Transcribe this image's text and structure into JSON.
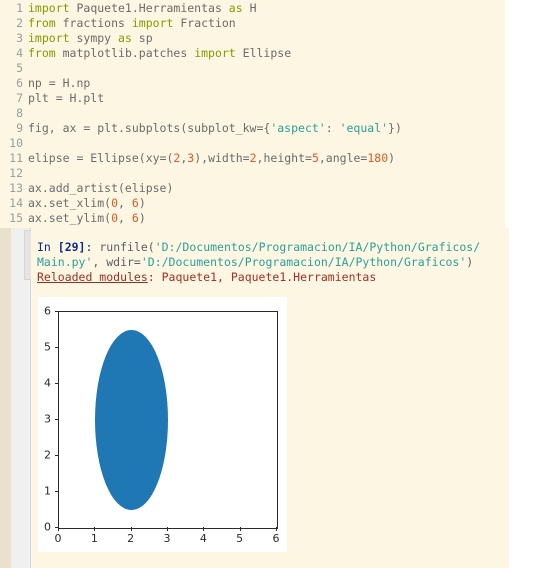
{
  "editor": {
    "name": "python-code-editor",
    "background": "#fdf6e3",
    "lines": [
      {
        "n": "1",
        "tokens": [
          {
            "t": "import",
            "c": "kw"
          },
          {
            "t": " Paquete1.Herramientas ",
            "c": "pln"
          },
          {
            "t": "as",
            "c": "kw"
          },
          {
            "t": " H",
            "c": "pln"
          }
        ]
      },
      {
        "n": "2",
        "tokens": [
          {
            "t": "from",
            "c": "kw"
          },
          {
            "t": " fractions ",
            "c": "pln"
          },
          {
            "t": "import",
            "c": "kw"
          },
          {
            "t": " Fraction",
            "c": "pln"
          }
        ]
      },
      {
        "n": "3",
        "tokens": [
          {
            "t": "import",
            "c": "kw"
          },
          {
            "t": " sympy ",
            "c": "pln"
          },
          {
            "t": "as",
            "c": "kw"
          },
          {
            "t": " sp",
            "c": "pln"
          }
        ]
      },
      {
        "n": "4",
        "tokens": [
          {
            "t": "from",
            "c": "kw"
          },
          {
            "t": " matplotlib.patches ",
            "c": "pln"
          },
          {
            "t": "import",
            "c": "kw"
          },
          {
            "t": " Ellipse",
            "c": "pln"
          }
        ]
      },
      {
        "n": "5",
        "tokens": []
      },
      {
        "n": "6",
        "tokens": [
          {
            "t": "np = H.np",
            "c": "pln"
          }
        ]
      },
      {
        "n": "7",
        "tokens": [
          {
            "t": "plt = H.plt",
            "c": "pln"
          }
        ]
      },
      {
        "n": "8",
        "tokens": []
      },
      {
        "n": "9",
        "tokens": [
          {
            "t": "fig, ax = plt.subplots(subplot_kw={",
            "c": "pln"
          },
          {
            "t": "'aspect'",
            "c": "str"
          },
          {
            "t": ": ",
            "c": "pln"
          },
          {
            "t": "'equal'",
            "c": "str"
          },
          {
            "t": "})",
            "c": "pln"
          }
        ]
      },
      {
        "n": "10",
        "tokens": []
      },
      {
        "n": "11",
        "tokens": [
          {
            "t": "elipse = Ellipse(xy=(",
            "c": "pln"
          },
          {
            "t": "2",
            "c": "num"
          },
          {
            "t": ",",
            "c": "pln"
          },
          {
            "t": "3",
            "c": "num"
          },
          {
            "t": "),width=",
            "c": "pln"
          },
          {
            "t": "2",
            "c": "num"
          },
          {
            "t": ",height=",
            "c": "pln"
          },
          {
            "t": "5",
            "c": "num"
          },
          {
            "t": ",angle=",
            "c": "pln"
          },
          {
            "t": "180",
            "c": "num"
          },
          {
            "t": ")",
            "c": "pln"
          }
        ]
      },
      {
        "n": "12",
        "tokens": []
      },
      {
        "n": "13",
        "tokens": [
          {
            "t": "ax.add_artist(elipse)",
            "c": "pln"
          }
        ]
      },
      {
        "n": "14",
        "tokens": [
          {
            "t": "ax.set_xlim(",
            "c": "pln"
          },
          {
            "t": "0",
            "c": "num"
          },
          {
            "t": ", ",
            "c": "pln"
          },
          {
            "t": "6",
            "c": "num"
          },
          {
            "t": ")",
            "c": "pln"
          }
        ]
      },
      {
        "n": "15",
        "tokens": [
          {
            "t": "ax.set_ylim(",
            "c": "pln"
          },
          {
            "t": "0",
            "c": "num"
          },
          {
            "t": ", ",
            "c": "pln"
          },
          {
            "t": "6",
            "c": "num"
          },
          {
            "t": ")",
            "c": "pln"
          }
        ]
      }
    ]
  },
  "console": {
    "name": "ipython-console",
    "background": "#fdf6e3",
    "lines": [
      {
        "tokens": [
          {
            "t": "In ",
            "c": "c-in"
          },
          {
            "t": "[29]",
            "c": "c-innum"
          },
          {
            "t": ": ",
            "c": "c-in"
          },
          {
            "t": "runfile(",
            "c": "c-fn"
          },
          {
            "t": "'D:/Documentos/Programacion/IA/Python/Graficos/",
            "c": "c-path"
          }
        ]
      },
      {
        "tokens": [
          {
            "t": "Main.py'",
            "c": "c-path"
          },
          {
            "t": ", wdir=",
            "c": "c-fn"
          },
          {
            "t": "'D:/Documentos/Programacion/IA/Python/Graficos'",
            "c": "c-path"
          },
          {
            "t": ")",
            "c": "c-fn"
          }
        ]
      },
      {
        "tokens": [
          {
            "t": "Reloaded modules",
            "c": "c-reload"
          },
          {
            "t": ": Paquete1, Paquete1.Herramientas",
            "c": "c-red"
          }
        ]
      }
    ]
  },
  "chart_data": {
    "type": "scatter",
    "title": "",
    "xlabel": "",
    "ylabel": "",
    "xlim": [
      0,
      6
    ],
    "ylim": [
      0,
      6
    ],
    "xticks": [
      0,
      1,
      2,
      3,
      4,
      5,
      6
    ],
    "yticks": [
      0,
      1,
      2,
      3,
      4,
      5,
      6
    ],
    "xticklabels": [
      "0",
      "1",
      "2",
      "3",
      "4",
      "5",
      "6"
    ],
    "yticklabels": [
      "0",
      "1",
      "2",
      "3",
      "4",
      "5",
      "6"
    ],
    "grid": false,
    "legend": false,
    "aspect": "equal",
    "figure_facecolor": "#ffffff",
    "axes_facecolor": "#ffffff",
    "spine_color": "#2b2b2b",
    "patches": [
      {
        "kind": "ellipse",
        "center_x": 2,
        "center_y": 3,
        "width": 2,
        "height": 5,
        "angle": 180,
        "facecolor": "#1f77b4",
        "x_extent": [
          1,
          3
        ],
        "y_extent": [
          0.5,
          5.5
        ]
      }
    ]
  }
}
